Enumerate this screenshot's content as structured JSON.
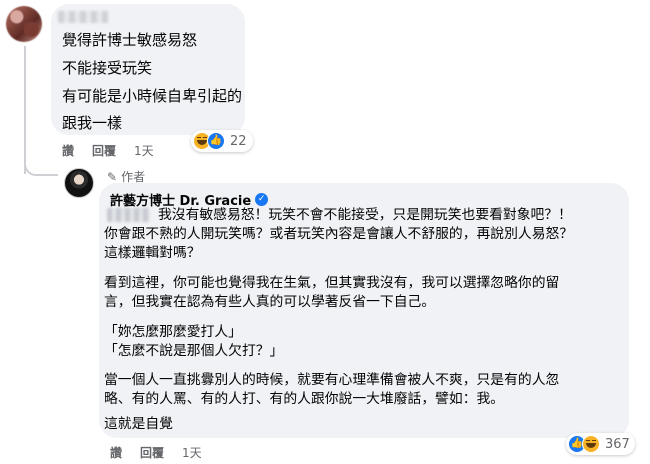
{
  "comment1": {
    "lines": [
      "覺得許博士敏感易怒",
      "不能接受玩笑",
      "有可能是小時候自卑引起的",
      "跟我一樣"
    ],
    "reactions": {
      "icons": [
        "haha-icon",
        "like-icon"
      ],
      "count": "22"
    },
    "actions": {
      "like": "讚",
      "reply": "回覆",
      "time": "1天"
    }
  },
  "reply": {
    "author_tag": "作者",
    "author_name": "許藝方博士 Dr. Gracie",
    "lines": [
      "我沒有敏感易怒！玩笑不會不能接受，只是開玩笑也要看對象吧？！",
      "你會跟不熟的人開玩笑嗎？或者玩笑內容是會讓人不舒服的，再說別人易怒？",
      "這樣邏輯對嗎？",
      "看到這裡，你可能也覺得我在生氣，但其實我沒有，我可以選擇忽略你的留",
      "言，但我實在認為有些人真的可以學著反省一下自己。",
      "「妳怎麼那麼愛打人」",
      "「怎麼不說是那個人欠打？」",
      "當一個人一直挑釁別人的時候，就要有心理準備會被人不爽，只是有的人忽",
      "略、有的人罵、有的人打、有的人跟你說一大堆廢話，譬如：我。",
      "這就是自覺"
    ],
    "reactions": {
      "icons": [
        "like-icon",
        "haha-icon"
      ],
      "count": "367"
    },
    "actions": {
      "like": "讚",
      "reply": "回覆",
      "time": "1天"
    }
  },
  "colors": {
    "bubble": "#f0f2f5",
    "secondary_text": "#65676b",
    "verified": "#1877f2",
    "haha": "#f7b125"
  }
}
